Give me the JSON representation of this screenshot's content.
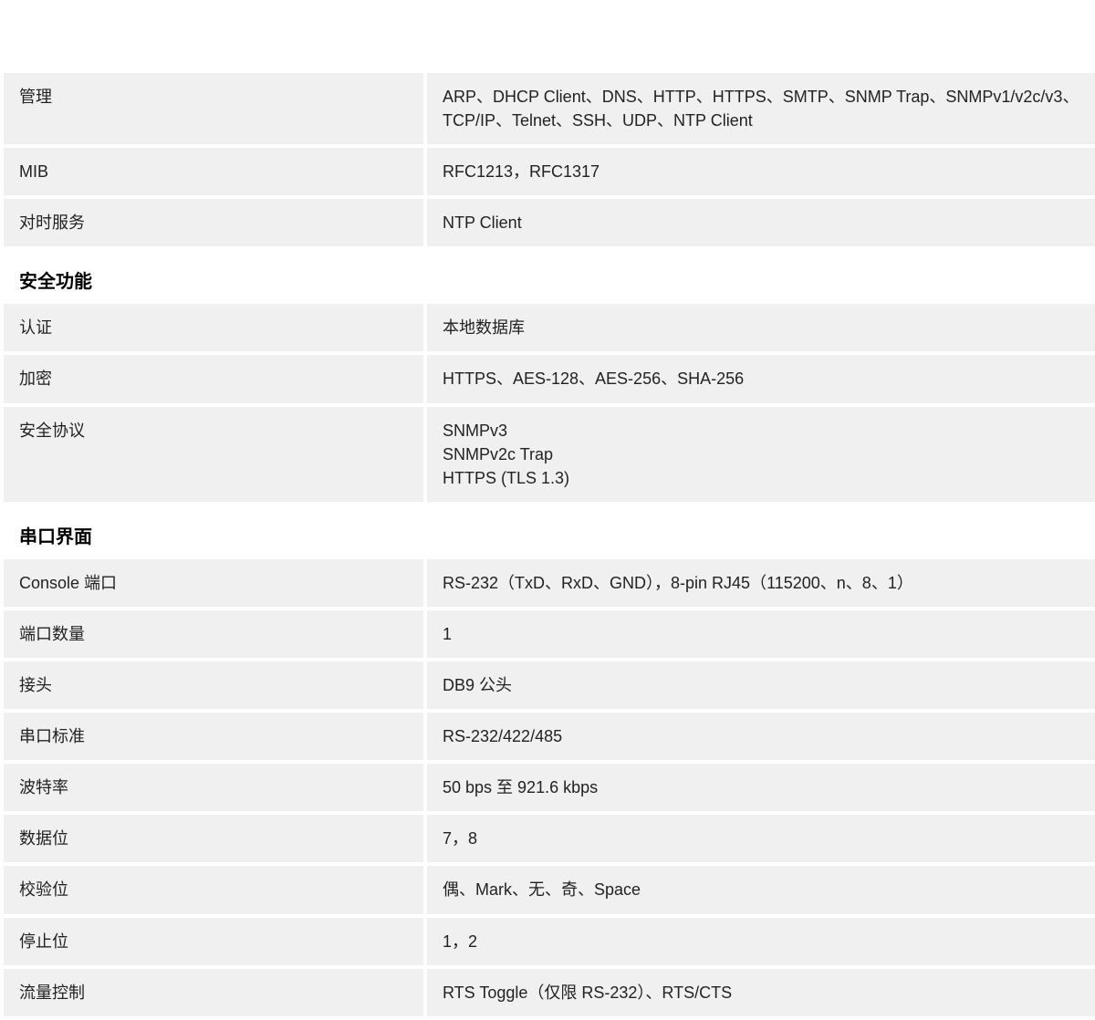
{
  "sections": [
    {
      "heading": null,
      "rows": [
        {
          "label": "管理",
          "value": "ARP、DHCP Client、DNS、HTTP、HTTPS、SMTP、SNMP Trap、SNMPv1/v2c/v3、TCP/IP、Telnet、SSH、UDP、NTP Client"
        },
        {
          "label": "MIB",
          "value": "RFC1213，RFC1317"
        },
        {
          "label": "对时服务",
          "value": "NTP Client"
        }
      ]
    },
    {
      "heading": "安全功能",
      "rows": [
        {
          "label": "认证",
          "value": "本地数据库"
        },
        {
          "label": "加密",
          "value": "HTTPS、AES-128、AES-256、SHA-256"
        },
        {
          "label": "安全协议",
          "value": "SNMPv3\nSNMPv2c Trap\nHTTPS (TLS 1.3)"
        }
      ]
    },
    {
      "heading": "串口界面",
      "rows": [
        {
          "label": "Console 端口",
          "value": "RS-232（TxD、RxD、GND），8-pin RJ45（115200、n、8、1）"
        },
        {
          "label": "端口数量",
          "value": "1"
        },
        {
          "label": "接头",
          "value": "DB9 公头"
        },
        {
          "label": "串口标准",
          "value": "RS-232/422/485"
        },
        {
          "label": "波特率",
          "value": "50 bps 至 921.6 kbps"
        },
        {
          "label": "数据位",
          "value": "7，8"
        },
        {
          "label": "校验位",
          "value": "偶、Mark、无、奇、Space"
        },
        {
          "label": "停止位",
          "value": "1，2"
        },
        {
          "label": "流量控制",
          "value": "RTS Toggle（仅限 RS-232）、RTS/CTS"
        }
      ]
    }
  ]
}
